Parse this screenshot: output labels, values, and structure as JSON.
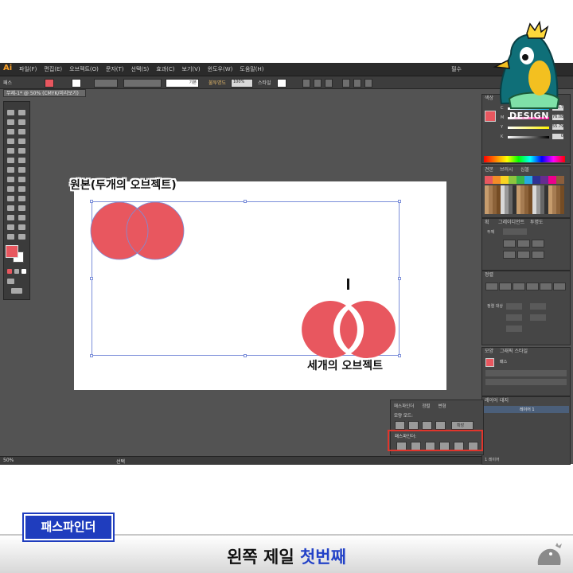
{
  "app": {
    "logo": "Ai",
    "menu_items": [
      "파일(F)",
      "편집(E)",
      "오브젝트(O)",
      "문자(T)",
      "선택(S)",
      "효과(C)",
      "보기(V)",
      "윈도우(W)",
      "도움말(H)"
    ],
    "workspace": "필수",
    "document_tab": "무제-1* @ 50% (CMYK/미리보기)",
    "control_bar": {
      "selection_label": "패스",
      "opacity_label": "불투명도",
      "opacity_value": "100%",
      "style_label": "스타일",
      "stroke_profile": "기본"
    },
    "status_zoom": "50%",
    "status_text": "선택"
  },
  "canvas": {
    "label_original": "원본(두개의 오브젝트)",
    "label_result": "세개의 오브젝트",
    "circle_color": "#e8575f"
  },
  "panels": {
    "color": {
      "tab": "색상",
      "labels": [
        "C",
        "M",
        "Y",
        "K"
      ],
      "values": [
        "6.7",
        "76.08",
        "55.79",
        "0"
      ]
    },
    "swatches": {
      "tabs": [
        "견본",
        "브러시",
        "심볼"
      ]
    },
    "stroke": {
      "tabs": [
        "획",
        "그레이디언트",
        "투명도"
      ],
      "weight_label": "두께"
    },
    "align": {
      "tab": "정렬",
      "label": "정렬 대상"
    },
    "appearance": {
      "tabs": [
        "모양",
        "그래픽 스타일"
      ],
      "path_label": "패스"
    },
    "layers": {
      "tabs": [
        "레이어",
        "대지"
      ],
      "layer_name": "레이어 1",
      "count": "1 레이어"
    }
  },
  "pathfinder": {
    "tabs": [
      "패스파인더",
      "정렬",
      "변형"
    ],
    "shape_modes_label": "모양 모드:",
    "expand_label": "확장",
    "pathfinders_label": "패스파인더:"
  },
  "brand": {
    "design_text": "DESIGN"
  },
  "caption": {
    "tag": "패스파인더",
    "text_plain": "왼쪽 제일 ",
    "text_highlight": "첫번째"
  }
}
